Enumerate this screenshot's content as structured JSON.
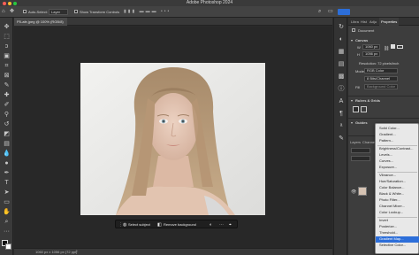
{
  "app": {
    "title": "Adobe Photoshop 2024"
  },
  "options_bar": {
    "auto_select_label": "Auto-Select:",
    "auto_select_value": "Layer",
    "show_transform_label": "Show Transform Controls"
  },
  "document": {
    "tab_label": "P5-afe.jpeg @ 100% (RGB/8)",
    "status": "1060 px x 1056 px (72 ppi)"
  },
  "context_bar": {
    "select_subject": "Select subject",
    "remove_background": "Remove background"
  },
  "panel": {
    "tabs": [
      "Libra",
      "Hist",
      "Adju",
      "Properties"
    ],
    "section_document": "Document",
    "canvas_label": "Canvas",
    "width_value": "1060 px",
    "height_value": "1056 px",
    "resolution": "Resolution: 72 pixels/inch",
    "mode_label": "Mode",
    "mode_value": "RGB Color",
    "bit_value": "8 Bits/Channel",
    "fill_label": "Fill",
    "fill_value": "Background Color",
    "rulers_grids": "Rulers & Grids",
    "guides": "Guides",
    "layers_tabs": [
      "Layers",
      "Channe"
    ]
  },
  "adjustment_menu": {
    "items": [
      "Solid Color...",
      "Gradient...",
      "Pattern...",
      "Brightness/Contrast...",
      "Levels...",
      "Curves...",
      "Exposure...",
      "Vibrance...",
      "Hue/Saturation...",
      "Color Balance...",
      "Black & White...",
      "Photo Filter...",
      "Channel Mixer...",
      "Color Lookup...",
      "Invert",
      "Posterize...",
      "Threshold...",
      "Gradient Map...",
      "Selective Color..."
    ],
    "highlighted": "Gradient Map..."
  },
  "colors": {
    "accent": "#2c6ed9",
    "canvas_bg": "#282828",
    "panel_bg": "#3d3d3d"
  }
}
